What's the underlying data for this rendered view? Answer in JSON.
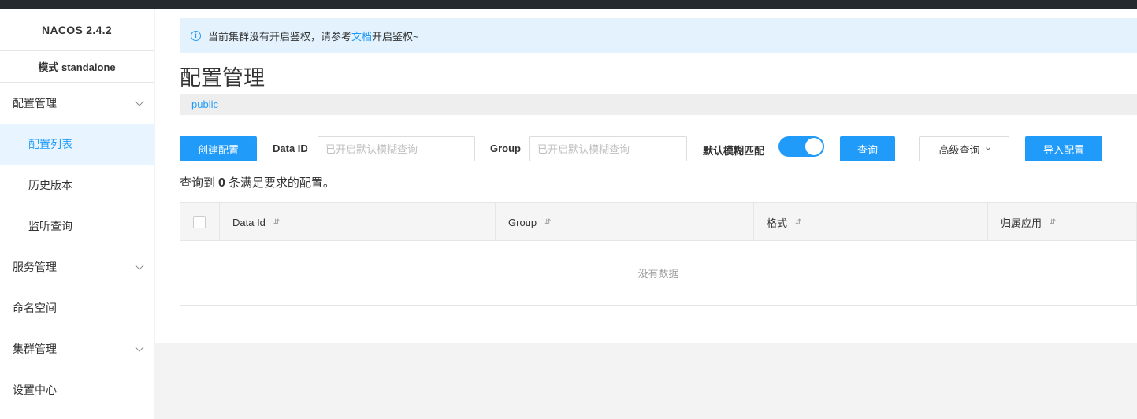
{
  "sidebar": {
    "brand": "NACOS 2.4.2",
    "mode": "模式 standalone",
    "items": [
      {
        "label": "配置管理"
      },
      {
        "label": "配置列表"
      },
      {
        "label": "历史版本"
      },
      {
        "label": "监听查询"
      },
      {
        "label": "服务管理"
      },
      {
        "label": "命名空间"
      },
      {
        "label": "集群管理"
      },
      {
        "label": "设置中心"
      }
    ]
  },
  "notice": {
    "prefix": "当前集群没有开启鉴权，请参考",
    "link": "文档",
    "suffix": "开启鉴权~"
  },
  "page": {
    "title": "配置管理",
    "namespace": "public"
  },
  "toolbar": {
    "create_label": "创建配置",
    "dataid_label": "Data ID",
    "dataid_placeholder": "已开启默认模糊查询",
    "group_label": "Group",
    "group_placeholder": "已开启默认模糊查询",
    "fuzzy_label": "默认模糊匹配",
    "fuzzy_enabled": true,
    "query_label": "查询",
    "advanced_label": "高级查询",
    "import_label": "导入配置"
  },
  "result": {
    "prefix": "查询到",
    "count": "0",
    "suffix": "条满足要求的配置。"
  },
  "table": {
    "columns": [
      "Data Id",
      "Group",
      "格式",
      "归属应用"
    ],
    "empty_text": "没有数据"
  },
  "colors": {
    "accent": "#209bfa",
    "topbar": "#252a2f"
  }
}
